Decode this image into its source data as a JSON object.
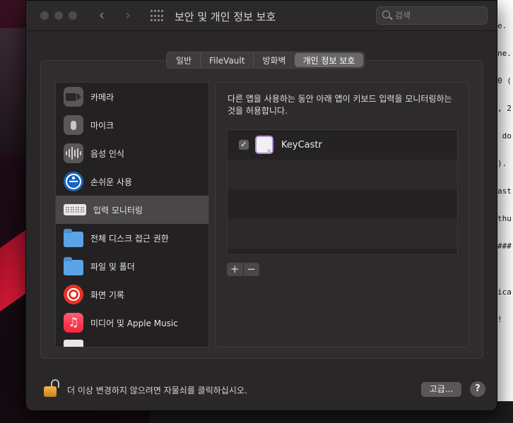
{
  "window": {
    "title": "보안 및 개인 정보 보호",
    "back": "‹",
    "forward": "›"
  },
  "search": {
    "placeholder": "검색"
  },
  "tabs": [
    {
      "label": "일반",
      "active": false
    },
    {
      "label": "FileVault",
      "active": false
    },
    {
      "label": "방화벽",
      "active": false
    },
    {
      "label": "개인 정보 보호",
      "active": true
    }
  ],
  "sidebar": {
    "items": [
      {
        "label": "카메라",
        "icon": "camera-icon"
      },
      {
        "label": "마이크",
        "icon": "microphone-icon"
      },
      {
        "label": "음성 인식",
        "icon": "speech-recognition-icon"
      },
      {
        "label": "손쉬운 사용",
        "icon": "accessibility-icon"
      },
      {
        "label": "입력 모니터링",
        "icon": "keyboard-icon",
        "selected": true
      },
      {
        "label": "전체 디스크 접근 권한",
        "icon": "folder-icon"
      },
      {
        "label": "파일 및 폴더",
        "icon": "folder-icon"
      },
      {
        "label": "화면 기록",
        "icon": "screen-record-icon"
      },
      {
        "label": "미디어 및 Apple Music",
        "icon": "music-icon"
      }
    ]
  },
  "detail": {
    "description": "다른 앱을 사용하는 동안 아래 앱이 키보드 입력을 모니터링하는 것을 허용합니다.",
    "apps": [
      {
        "name": "KeyCastr",
        "checked": true,
        "checkmark": "✓"
      }
    ],
    "add_label": "+",
    "remove_label": "−"
  },
  "footer": {
    "lock_text": "더 이상 변경하지 않으려면 자물쇠를 클릭하십시오.",
    "advanced_label": "고급...",
    "help_label": "?"
  },
  "terminal": {
    "lines": [
      "e.",
      "ne.",
      "0 (",
      ", 2",
      " do",
      ").",
      "ast",
      "thu",
      "###",
      "",
      "ica",
      "!"
    ]
  }
}
